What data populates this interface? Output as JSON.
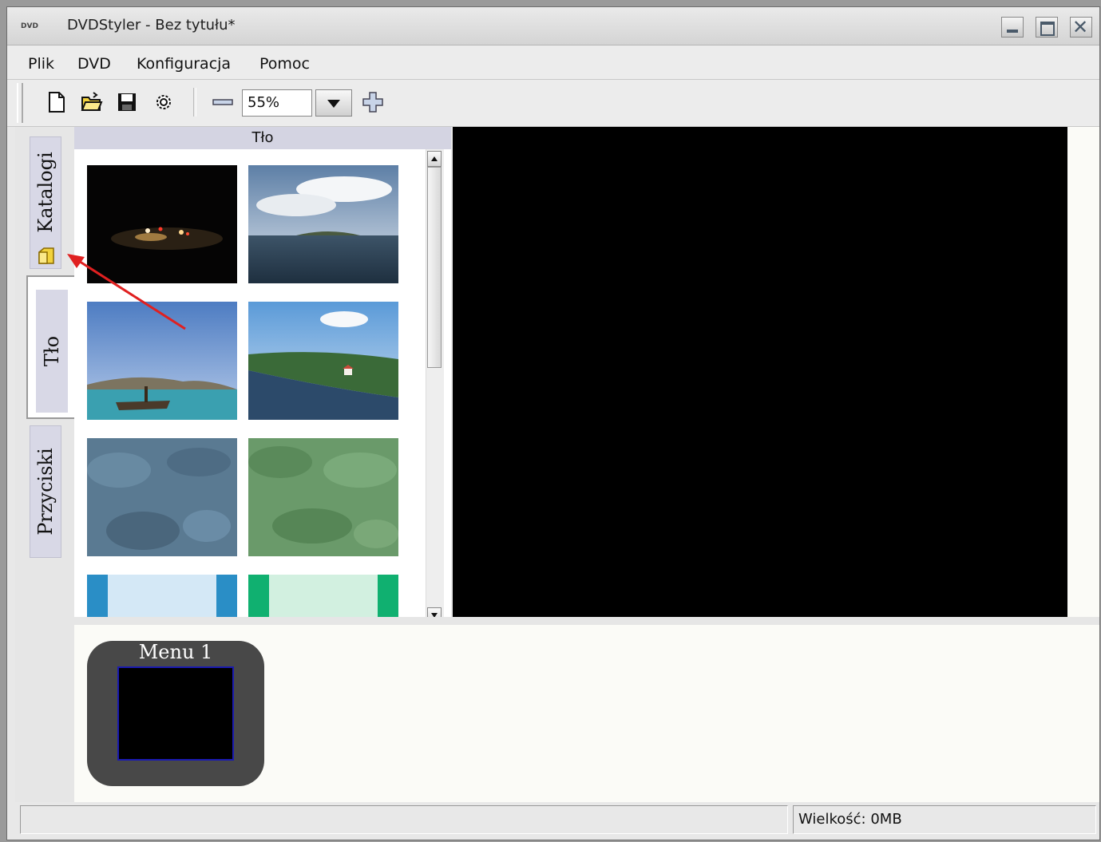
{
  "window": {
    "title": "DVDStyler - Bez tytułu*",
    "app_icon_text": "DVD"
  },
  "menu": [
    {
      "label": "Plik"
    },
    {
      "label": "DVD"
    },
    {
      "label": "Konfiguracja"
    },
    {
      "label": "Pomoc"
    }
  ],
  "toolbar": {
    "zoom_value": "55%"
  },
  "sidebar": {
    "tabs": [
      {
        "label": "Katalogi",
        "icon": "folder-icon",
        "active": false
      },
      {
        "label": "Tło",
        "active": true
      },
      {
        "label": "Przyciski",
        "active": false
      }
    ]
  },
  "background_panel": {
    "header": "Tło",
    "thumbnails": [
      {
        "name": "night-road"
      },
      {
        "name": "sea-clouds"
      },
      {
        "name": "ship-coast"
      },
      {
        "name": "river-village"
      },
      {
        "name": "blue-camouflage"
      },
      {
        "name": "green-camouflage"
      },
      {
        "name": "blue-stripes"
      },
      {
        "name": "green-stripes"
      }
    ]
  },
  "menus_panel": {
    "menu_card_title": "Menu 1"
  },
  "statusbar": {
    "size_text": "Wielkość: 0MB"
  },
  "colors": {
    "annotation_arrow": "#e02020",
    "tab_bg": "#d8d8e6",
    "preview_bg": "#000000",
    "menu_card_bg": "#484848",
    "menu_screen_border": "#1a1ab0"
  }
}
